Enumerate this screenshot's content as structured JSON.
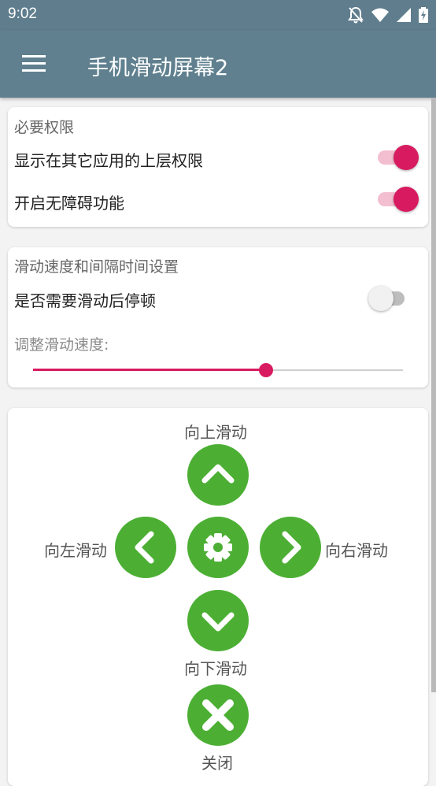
{
  "status_bar": {
    "time": "9:02",
    "icons": [
      "notifications-off-icon",
      "wifi-icon",
      "cellular-signal-icon",
      "battery-charging-icon"
    ]
  },
  "app_bar": {
    "title": "手机滑动屏幕2",
    "menu_icon": "hamburger-menu-icon"
  },
  "permissions": {
    "header": "必要权限",
    "overlay_label": "显示在其它应用的上层权限",
    "overlay_enabled": true,
    "accessibility_label": "开启无障碍功能",
    "accessibility_enabled": true
  },
  "speed_settings": {
    "header": "滑动速度和间隔时间设置",
    "pause_label": "是否需要滑动后停顿",
    "pause_enabled": false,
    "speed_label": "调整滑动速度:",
    "speed_value": 0.63
  },
  "controls": {
    "up_label": "向上滑动",
    "left_label": "向左滑动",
    "right_label": "向右滑动",
    "down_label": "向下滑动",
    "close_label": "关闭"
  },
  "colors": {
    "app_bar": "#60808f",
    "accent": "#d81b60",
    "control_green": "#4caf34"
  }
}
